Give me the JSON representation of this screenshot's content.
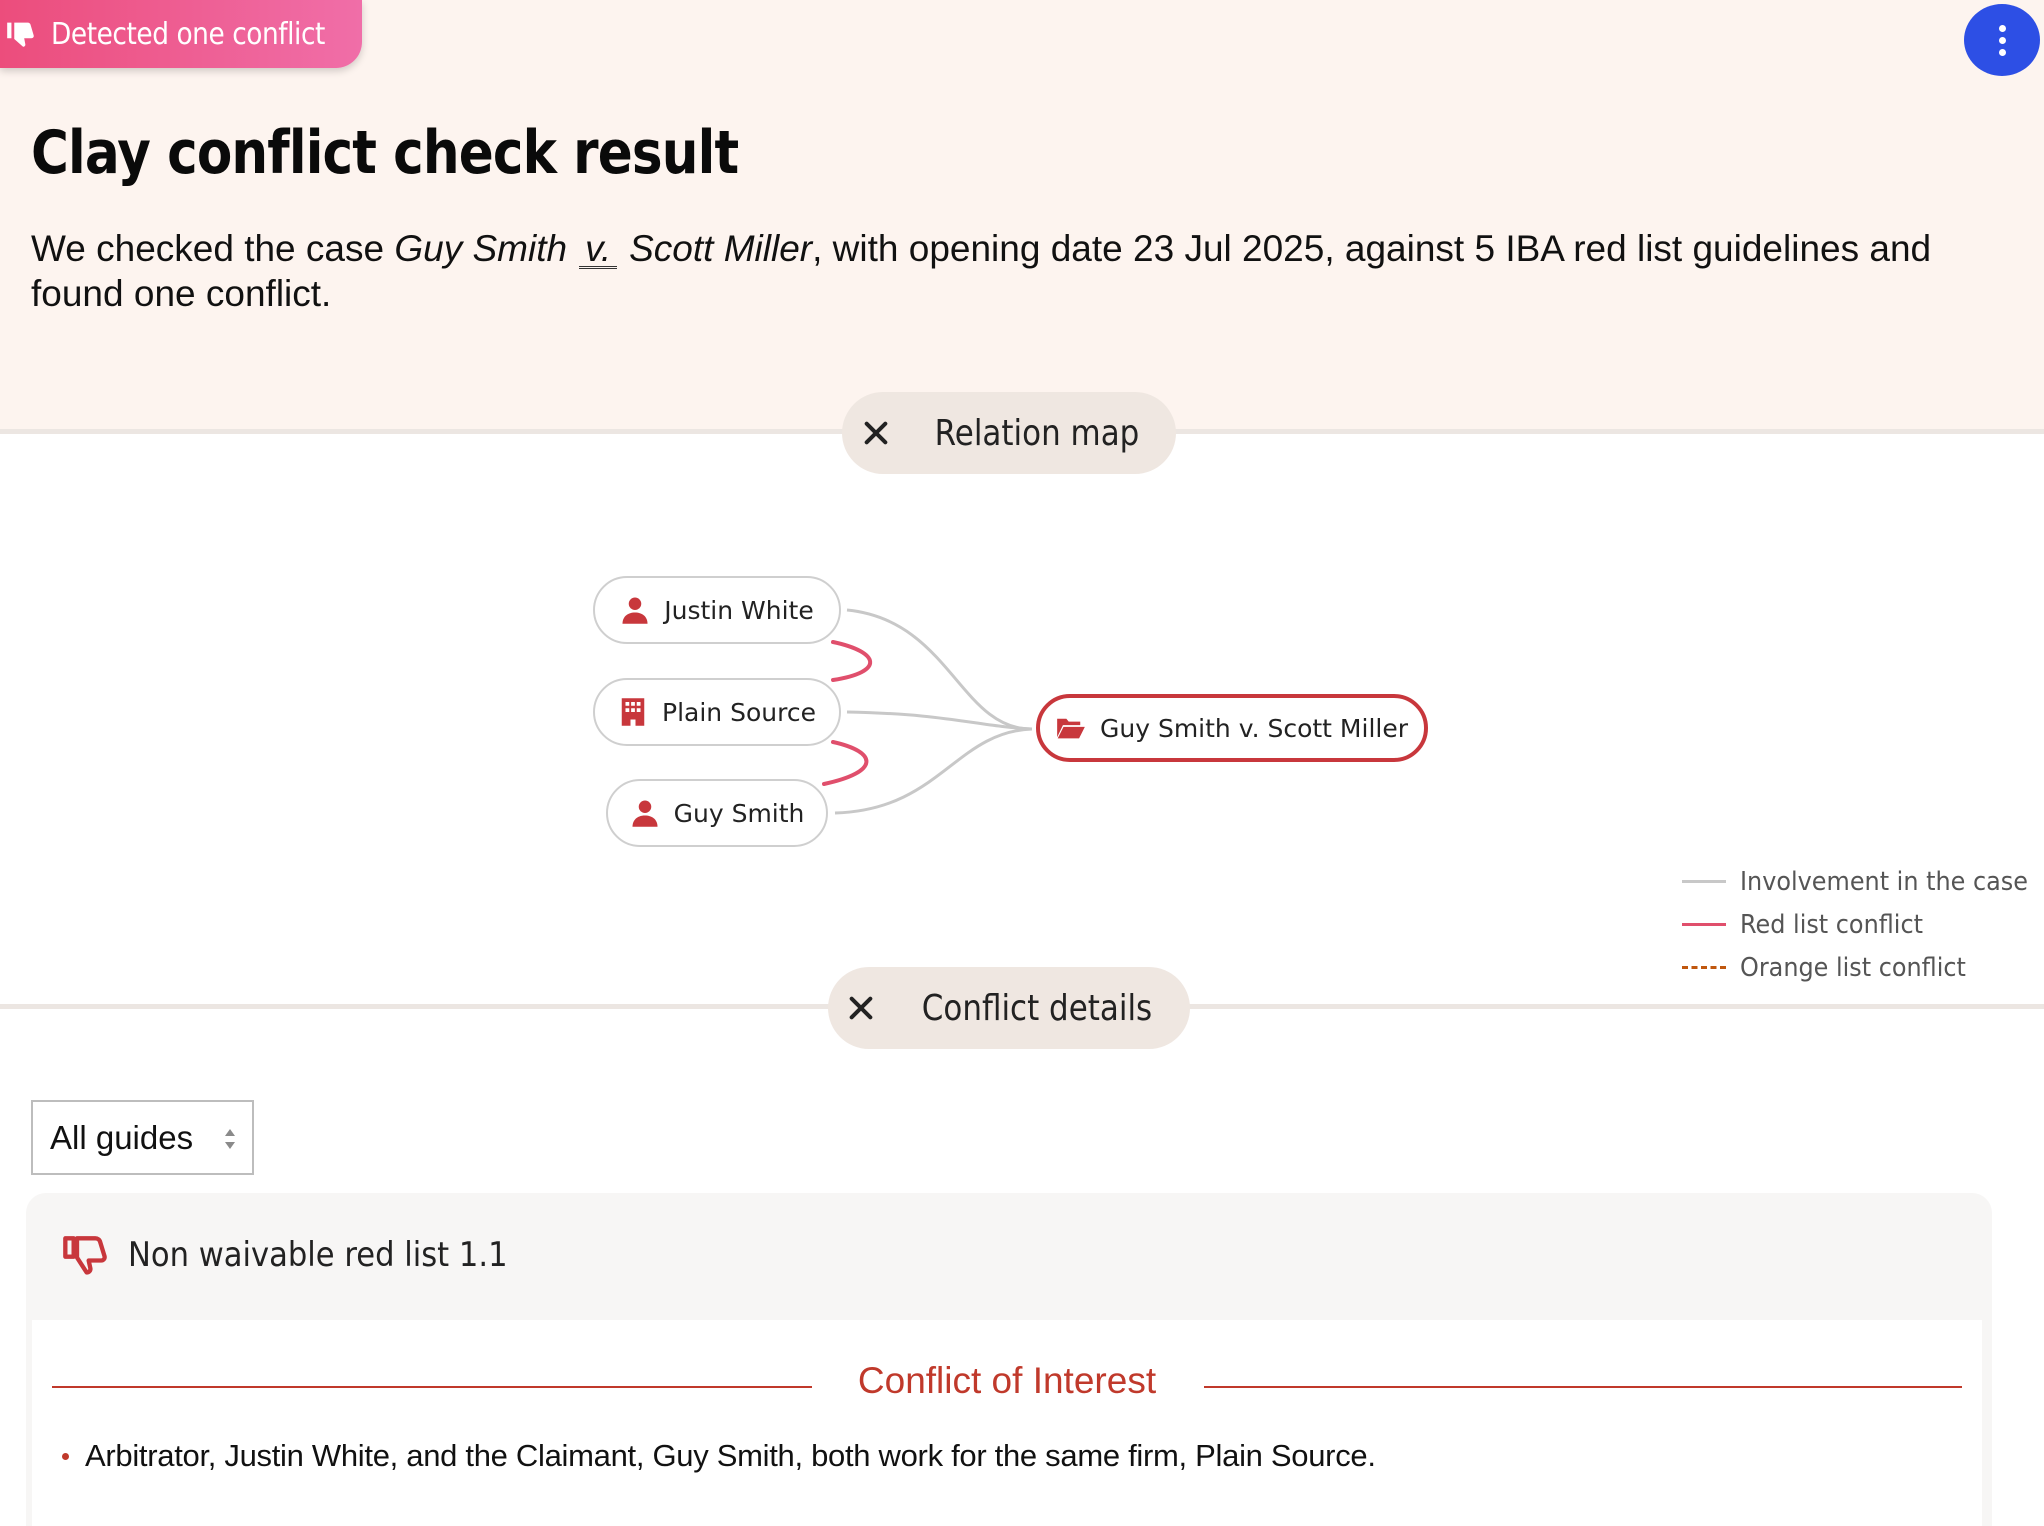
{
  "badge": {
    "label": "Detected one conflict",
    "icon": "thumbs-down-icon",
    "color": "#ec4d7c"
  },
  "menu": {
    "icon": "vertical-dots-icon",
    "color": "#2d4fe5"
  },
  "page": {
    "title": "Clay conflict check result"
  },
  "summary": {
    "prefix": "We checked the case",
    "claimant": "Guy Smith",
    "versus": "v.",
    "respondent": "Scott Miller",
    "suffix": ", with opening date 23 Jul 2025, against 5 IBA red list guidelines and found one conflict."
  },
  "relation_map": {
    "toggle_label": "Relation map",
    "toggle_icon": "close-icon",
    "nodes": [
      {
        "label": "Justin White",
        "icon": "person-icon"
      },
      {
        "label": "Plain Source",
        "icon": "building-icon"
      },
      {
        "label": "Guy Smith",
        "icon": "person-icon"
      }
    ],
    "case_node": {
      "label": "Guy Smith v. Scott Miller",
      "icon": "folder-open-icon"
    },
    "legend": [
      {
        "label": "Involvement in the case",
        "color": "#c8c8c8"
      },
      {
        "label": "Red list conflict",
        "color": "#e04f6c"
      },
      {
        "label": "Orange list conflict",
        "color": "#c0570f"
      }
    ]
  },
  "conflict_details": {
    "toggle_label": "Conflict details",
    "toggle_icon": "close-icon",
    "filter": {
      "selected": "All guides"
    },
    "guidelines": [
      {
        "name": "Non waivable red list 1.1",
        "icon": "thumbs-down-icon",
        "heading": "Conflict of Interest",
        "items": [
          "Arbitrator, Justin White, and the Claimant, Guy Smith, both work for the same firm, Plain Source."
        ]
      }
    ]
  }
}
